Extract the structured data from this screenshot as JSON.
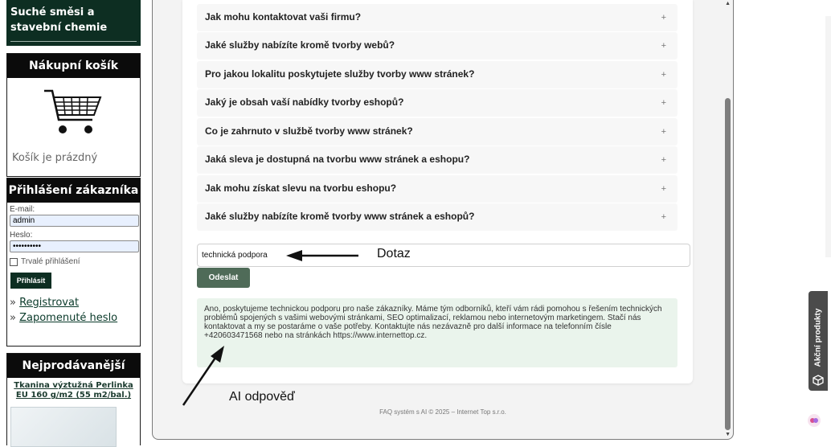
{
  "sidebar": {
    "category_title": "Suché směsi a stavební chemie",
    "cart": {
      "title": "Nákupní košík",
      "empty_text": "Košík je prázdný"
    },
    "login": {
      "title": "Přihlášení zákazníka",
      "email_label": "E-mail:",
      "email_value": "admin",
      "password_label": "Heslo:",
      "password_value": "••••••••••",
      "remember_label": "Trvalé přihlášení",
      "submit_label": "Přihlásit",
      "register_prefix": "»",
      "register_label": "Registrovat",
      "forgot_prefix": "»",
      "forgot_label": "Zapomenuté heslo"
    },
    "bestsellers": {
      "title": "Nejprodávanější zboží",
      "item_label": "Tkanina výztužná Perlinka EU 160 g/m2 (55 m2/bal.)"
    }
  },
  "faq": {
    "questions": [
      "Jak mohu kontaktovat vaši firmu?",
      "Jaké služby nabízíte kromě tvorby webů?",
      "Pro jakou lokalitu poskytujete služby tvorby www stránek?",
      "Jaký je obsah vaší nabídky tvorby eshopů?",
      "Co je zahrnuto v službě tvorby www stránek?",
      "Jaká sleva je dostupná na tvorbu www stránek a eshopu?",
      "Jak mohu získat slevu na tvorbu eshopu?",
      "Jaké služby nabízíte kromě tvorby www stránek a eshopů?"
    ],
    "expand_symbol": "+",
    "query_value": "technická podpora",
    "send_label": "Odeslat",
    "answer": "Ano, poskytujeme technickou podporu pro naše zákazníky. Máme tým odborníků, kteří vám rádi pomohou s řešením technických problémů spojených s vašimi webovými stránkami, SEO optimalizací, reklamou nebo internetovým marketingem. Stačí nás kontaktovat a my se postaráme o vaše potřeby. Kontaktujte nás nezávazně pro další informace na telefonním čísle +420603471568 nebo na stránkách https://www.internettop.cz.",
    "footer": "FAQ systém s AI © 2025 – Internet Top s.r.o."
  },
  "annotations": {
    "query_note": "Dotaz",
    "answer_note": "AI odpověď"
  },
  "side_widget": {
    "label": "Akční produkty",
    "icon": "box-icon"
  },
  "colors": {
    "sidebar_dark": "#0d2e22",
    "button_green": "#4f6b58",
    "answer_bg": "#eaf4ec"
  }
}
